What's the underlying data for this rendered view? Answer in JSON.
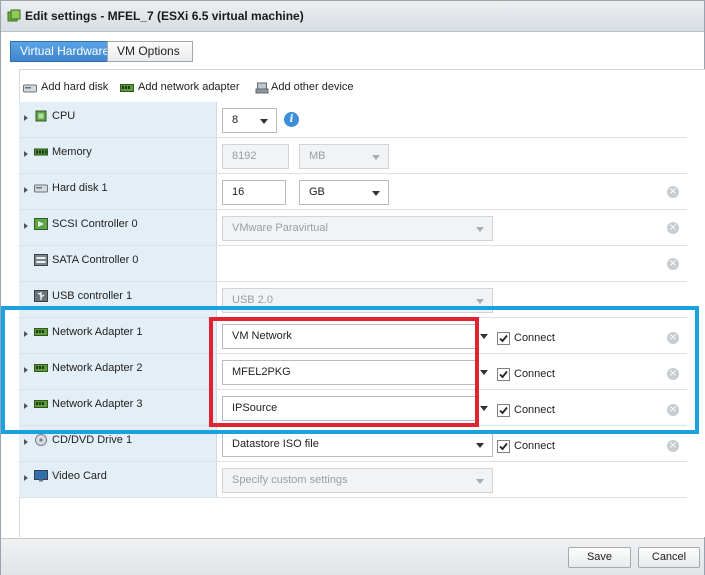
{
  "window": {
    "title": "Edit settings - MFEL_7 (ESXi 6.5 virtual machine)"
  },
  "tabs": [
    {
      "label": "Virtual Hardware",
      "active": true
    },
    {
      "label": "VM Options",
      "active": false
    }
  ],
  "toolbar": {
    "add_hard_disk": "Add hard disk",
    "add_network_adapter": "Add network adapter",
    "add_other_device": "Add other device"
  },
  "devices": {
    "cpu": {
      "label": "CPU",
      "value": "8"
    },
    "memory": {
      "label": "Memory",
      "value": "8192",
      "unit": "MB"
    },
    "hard_disk_1": {
      "label": "Hard disk 1",
      "value": "16",
      "unit": "GB"
    },
    "scsi_controller_0": {
      "label": "SCSI Controller 0",
      "value": "VMware Paravirtual"
    },
    "sata_controller_0": {
      "label": "SATA Controller 0"
    },
    "usb_controller_1": {
      "label": "USB controller 1",
      "value": "USB 2.0"
    },
    "network_adapter_1": {
      "label": "Network Adapter 1",
      "value": "VM Network",
      "connect_label": "Connect",
      "connected": true
    },
    "network_adapter_2": {
      "label": "Network Adapter 2",
      "value": "MFEL2PKG",
      "connect_label": "Connect",
      "connected": true
    },
    "network_adapter_3": {
      "label": "Network Adapter 3",
      "value": "IPSource",
      "connect_label": "Connect",
      "connected": true
    },
    "cd_dvd_drive_1": {
      "label": "CD/DVD Drive 1",
      "value": "Datastore ISO file",
      "connect_label": "Connect",
      "connected": true
    },
    "video_card": {
      "label": "Video Card",
      "value": "Specify custom settings"
    }
  },
  "footer": {
    "save_label": "Save",
    "cancel_label": "Cancel"
  },
  "colors": {
    "accent": "#3f86cc",
    "row_label_bg": "#e4eef6",
    "highlight_blue": "#1aa1df",
    "highlight_red": "#e0232e"
  },
  "icons": {
    "window": "vm-icon",
    "add_hard_disk": "hard-disk-icon",
    "add_network_adapter": "network-card-icon",
    "add_other_device": "device-icon",
    "info": "info-icon",
    "remove": "remove-icon"
  }
}
